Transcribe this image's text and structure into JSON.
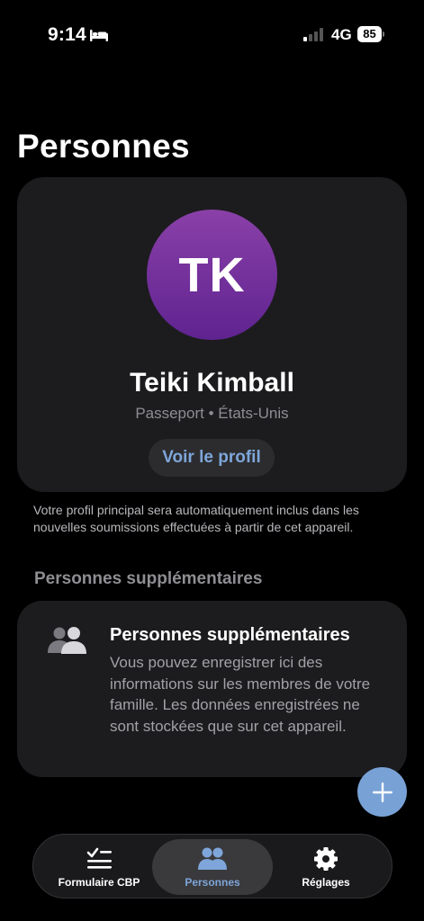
{
  "status_bar": {
    "time": "9:14",
    "network": "4G",
    "battery": "85",
    "icons": [
      "bed-icon",
      "signal-icon",
      "battery-icon"
    ]
  },
  "page": {
    "title": "Personnes"
  },
  "profile_card": {
    "initials": "TK",
    "name": "Teiki Kimball",
    "document": "Passeport • États-Unis",
    "button_label": "Voir le profil",
    "avatar_color": "#7b32a0"
  },
  "footnote": "Votre profil principal sera automatiquement inclus dans les nouvelles soumissions effectuées à partir de cet appareil.",
  "additional_section": {
    "header": "Personnes supplémentaires",
    "card_title": "Personnes supplémentaires",
    "card_body": "Vous pouvez enregistrer ici des informations sur les membres de votre famille. Les données enregistrées ne sont stockées que sur cet appareil.",
    "icon": "people-icon"
  },
  "fab": {
    "icon": "plus-icon",
    "color": "#78a2d6"
  },
  "tab_bar": {
    "tabs": [
      {
        "label": "Formulaire CBP",
        "icon": "checklist-icon",
        "selected": false
      },
      {
        "label": "Personnes",
        "icon": "people-icon",
        "selected": true
      },
      {
        "label": "Réglages",
        "icon": "gear-icon",
        "selected": false
      }
    ],
    "accent": "#7ea6da"
  }
}
